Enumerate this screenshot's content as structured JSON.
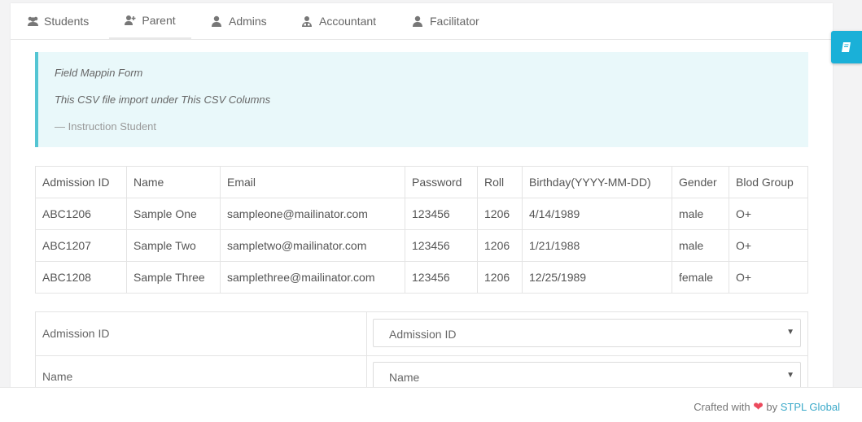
{
  "tabs": [
    {
      "label": "Students",
      "icon": "users-icon"
    },
    {
      "label": "Parent",
      "icon": "user-plus-icon"
    },
    {
      "label": "Admins",
      "icon": "user-icon"
    },
    {
      "label": "Accountant",
      "icon": "user-tie-icon"
    },
    {
      "label": "Facilitator",
      "icon": "user-icon"
    }
  ],
  "instruction": {
    "line1": "Field Mappin Form",
    "line2": "This CSV file import under This CSV Columns",
    "source": "— Instruction Student"
  },
  "sample_table": {
    "headers": [
      "Admission ID",
      "Name",
      "Email",
      "Password",
      "Roll",
      "Birthday(YYYY-MM-DD)",
      "Gender",
      "Blod Group"
    ],
    "rows": [
      [
        "ABC1206",
        "Sample One",
        "sampleone@mailinator.com",
        "123456",
        "1206",
        "4/14/1989",
        "male",
        "O+"
      ],
      [
        "ABC1207",
        "Sample Two",
        "sampletwo@mailinator.com",
        "123456",
        "1206",
        "1/21/1988",
        "male",
        "O+"
      ],
      [
        "ABC1208",
        "Sample Three",
        "samplethree@mailinator.com",
        "123456",
        "1206",
        "12/25/1989",
        "female",
        "O+"
      ]
    ]
  },
  "mapping": [
    {
      "label": "Admission ID",
      "selected": "Admission ID"
    },
    {
      "label": "Name",
      "selected": "Name"
    }
  ],
  "footer": {
    "prefix": "Crafted with",
    "by": "by",
    "brand": "STPL Global"
  },
  "colors": {
    "accent": "#54c5d3",
    "side_button": "#1ab0d8",
    "heart": "#ec4a5d",
    "brand": "#3aa9c9"
  }
}
